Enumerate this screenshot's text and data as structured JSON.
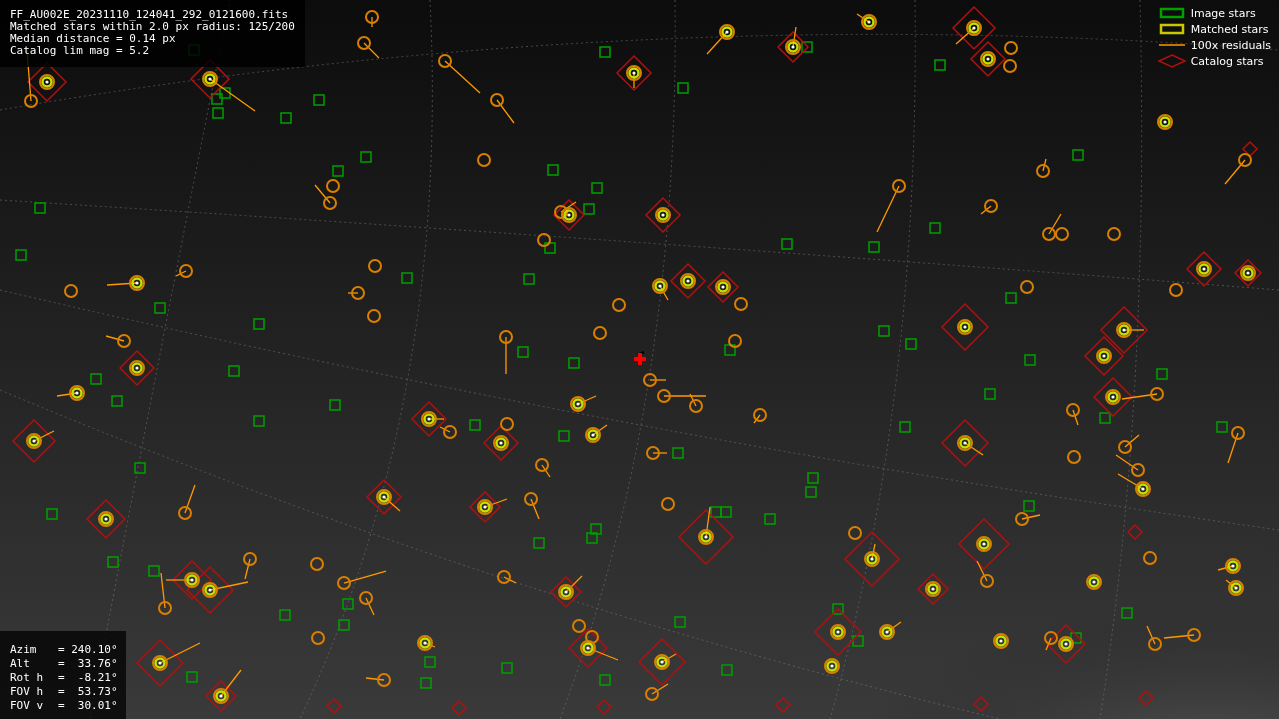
{
  "header_lines": [
    "FF_AU002E_20231110_124041_292_0121600.fits",
    "Matched stars within 2.0 px radius: 125/200",
    "Median distance = 0.14 px",
    "Catalog lim mag = 5.2"
  ],
  "legend": [
    {
      "kind": "image",
      "label": "Image stars"
    },
    {
      "kind": "matched",
      "label": "Matched stars"
    },
    {
      "kind": "residual",
      "label": "100x residuals"
    },
    {
      "kind": "catalog",
      "label": "Catalog stars"
    }
  ],
  "pointing": [
    {
      "name": "Azim",
      "value": "= 240.10°"
    },
    {
      "name": "Alt",
      "value": "=  33.76°"
    },
    {
      "name": "Rot h",
      "value": "=  -8.21°"
    },
    {
      "name": "FOV h",
      "value": "=  53.73°"
    },
    {
      "name": "FOV v",
      "value": "=  30.01°"
    }
  ]
}
